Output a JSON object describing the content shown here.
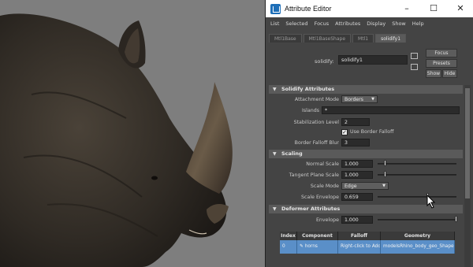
{
  "window": {
    "title": "Attribute Editor",
    "controls": {
      "minimize": "–",
      "maximize": "☐",
      "close": "✕"
    }
  },
  "menu": [
    "List",
    "Selected",
    "Focus",
    "Attributes",
    "Display",
    "Show",
    "Help"
  ],
  "tabs": [
    {
      "label": "Mtl1Base",
      "active": false
    },
    {
      "label": "Mtl1BaseShape",
      "active": false
    },
    {
      "label": "Mtl1",
      "active": false
    },
    {
      "label": "solidify1",
      "active": true
    }
  ],
  "node": {
    "label": "solidify:",
    "value": "solidify1",
    "buttons": {
      "focus": "Focus",
      "presets": "Presets",
      "show": "Show",
      "hide": "Hide"
    }
  },
  "sections": {
    "solidify": {
      "title": "Solidify Attributes",
      "attachment_mode_label": "Attachment Mode",
      "attachment_mode_value": "Borders",
      "islands_label": "Islands",
      "islands_value": "*",
      "stabilization_label": "Stabilization Level",
      "stabilization_value": "2",
      "use_border_falloff_label": "Use Border Falloff",
      "use_border_falloff_checked": true,
      "border_falloff_blur_label": "Border Falloff Blur",
      "border_falloff_blur_value": "3"
    },
    "scaling": {
      "title": "Scaling",
      "normal_scale_label": "Normal Scale",
      "normal_scale_value": "1.000",
      "normal_scale_slider": 0.1,
      "tangent_plane_scale_label": "Tangent Plane Scale",
      "tangent_plane_scale_value": "1.000",
      "tangent_plane_scale_slider": 0.1,
      "scale_mode_label": "Scale Mode",
      "scale_mode_value": "Edge",
      "scale_envelope_label": "Scale Envelope",
      "scale_envelope_value": "0.659",
      "scale_envelope_slider": 0.659
    },
    "deformer": {
      "title": "Deformer Attributes",
      "envelope_label": "Envelope",
      "envelope_value": "1.000",
      "envelope_slider": 1.0
    }
  },
  "table": {
    "headers": [
      "Index",
      "Component Tag",
      "Falloff",
      "Geometry"
    ],
    "rows": [
      {
        "index": "0",
        "component_tag": "horns",
        "falloff": "Right-click to Add",
        "geometry": "modelsRhino_body_geo_Shape"
      }
    ]
  },
  "colors": {
    "panel_bg": "#444444",
    "section_bg": "#5a5a5a",
    "selected_row": "#5a8fc8",
    "viewport_bg": "#7e7e7e"
  }
}
